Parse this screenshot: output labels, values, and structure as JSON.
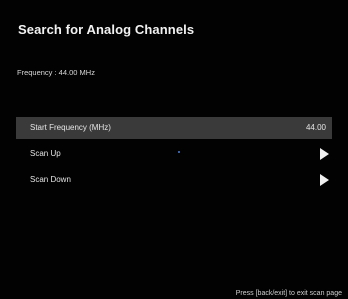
{
  "panel": {
    "title": "Search for Analog Channels",
    "frequency_text": "Frequency : 44.00 MHz"
  },
  "menu": {
    "items": [
      {
        "label": "Start Frequency (MHz)",
        "value": "44.00",
        "selected": true
      },
      {
        "label": "Scan Up",
        "icon": "play-arrow-icon"
      },
      {
        "label": "Scan Down",
        "icon": "play-arrow-icon"
      }
    ]
  },
  "footer": {
    "hint": "Press [back/exit] to exit scan page"
  },
  "colors": {
    "background": "#020202",
    "selected_row": "#3a3a3a",
    "text": "#e6e6e6",
    "indicator_dot": "#4a7fd6"
  }
}
